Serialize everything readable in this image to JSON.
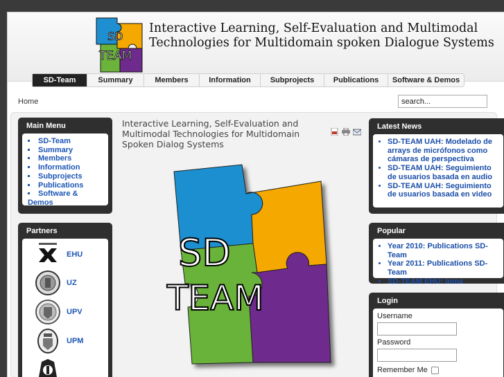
{
  "site": {
    "title": "Interactive Learning, Self-Evaluation and Multimodal Technologies for Multidomain spoken Dialogue Systems",
    "logo_text_top": "SD",
    "logo_text_bottom": "TEAM"
  },
  "nav": {
    "items": [
      "SD-Team",
      "Summary",
      "Members",
      "Information",
      "Subprojects",
      "Publications",
      "Software & Demos"
    ],
    "active": "SD-Team"
  },
  "breadcrumb": "Home",
  "search": {
    "value": "search..."
  },
  "main_menu": {
    "title": "Main Menu",
    "items": [
      "SD-Team",
      "Summary",
      "Members",
      "Information",
      "Subprojects",
      "Publications",
      "Software & Demos"
    ]
  },
  "partners": {
    "title": "Partners",
    "items": [
      "EHU",
      "UZ",
      "UPV",
      "UPM"
    ]
  },
  "article": {
    "title": "Interactive Learning, Self-Evaluation and Multimodal Technologies for Multidomain Spoken Dialog Systems",
    "logo_text_top": "SD",
    "logo_text_bottom": "TEAM"
  },
  "icons": {
    "pdf": "pdf-icon",
    "print": "print-icon",
    "email": "email-icon"
  },
  "latest_news": {
    "title": "Latest News",
    "items": [
      "SD-TEAM UAH: Modelado de arrays de micrófonos como cámaras de perspectiva",
      "SD-TEAM UAH: Seguimiento de usuarios basada en audio",
      "SD-TEAM UAH: Seguimiento de usuarios basada en video"
    ]
  },
  "popular": {
    "title": "Popular",
    "items": [
      "Year 2010: Publications SD-Team",
      "Year 2011: Publications SD-Team",
      "SD-TEAM EHU: Inma"
    ]
  },
  "login": {
    "title": "Login",
    "username_label": "Username",
    "password_label": "Password",
    "remember_label": "Remember Me"
  },
  "colors": {
    "puzzle_blue": "#1e8fd0",
    "puzzle_orange": "#f5a800",
    "puzzle_green": "#6bb33a",
    "puzzle_purple": "#6e2a8c",
    "link_blue": "#1a55b5"
  }
}
